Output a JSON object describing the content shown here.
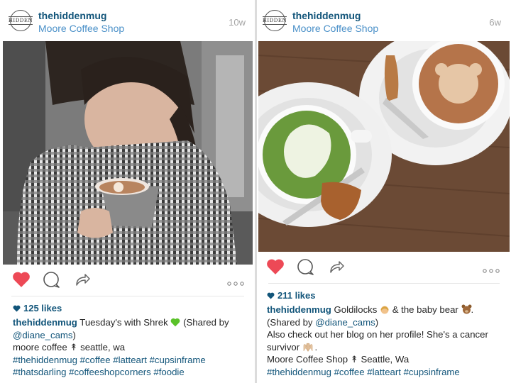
{
  "left_post": {
    "username": "thehiddenmug",
    "location": "Moore Coffee Shop",
    "time_ago": "10w",
    "avatar_text": "HIDDEN",
    "likes": "125 likes",
    "caption_username": "thehiddenmug",
    "caption_text": "Tuesday's with Shrek",
    "caption_shared_prefix": "(Shared by",
    "caption_shared_user": "@diane_cams",
    "caption_shared_suffix": ")",
    "caption_line2": "moore coffee ↟ seattle, wa",
    "caption_tags": "#thehiddenmug #coffee #latteart #cupsinframe #thatsdarling #coffeeshopcorners #foodie",
    "colors": {
      "heart_filled": "#ed4956",
      "emoji_heart": "#5ac229"
    }
  },
  "right_post": {
    "username": "thehiddenmug",
    "location": "Moore Coffee Shop",
    "time_ago": "6w",
    "avatar_text": "HIDDEN",
    "likes": "211 likes",
    "caption_username": "thehiddenmug",
    "caption_text_a": "Goldilocks",
    "caption_text_b": "& the baby bear",
    "caption_shared_prefix": "(Shared by",
    "caption_shared_user": "@diane_cams",
    "caption_shared_suffix": ")",
    "caption_line2": "Also check out her blog on her profile! She's a cancer survivor",
    "caption_line2_end": ".",
    "caption_line3": "Moore Coffee Shop ↟ Seattle, Wa",
    "caption_tags": "#thehiddenmug #coffee #latteart #cupsinframe",
    "colors": {
      "heart_filled": "#ed4956"
    }
  },
  "icons": {
    "heart": "heart-icon",
    "comment": "comment-bubble-icon",
    "share": "share-arrow-icon",
    "more": "more-dots-icon"
  }
}
